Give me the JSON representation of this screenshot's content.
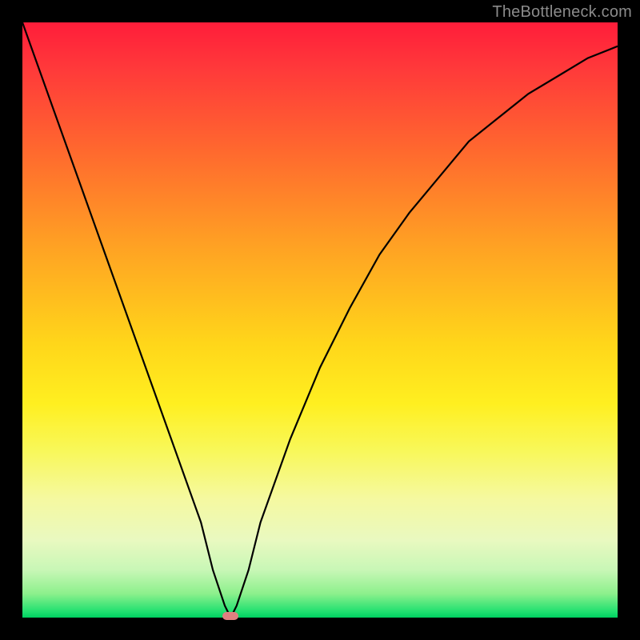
{
  "watermark": "TheBottleneck.com",
  "chart_data": {
    "type": "line",
    "title": "",
    "xlabel": "",
    "ylabel": "",
    "xlim": [
      0,
      100
    ],
    "ylim": [
      0,
      100
    ],
    "x": [
      0,
      5,
      10,
      15,
      20,
      25,
      30,
      32,
      34,
      35,
      36,
      38,
      40,
      45,
      50,
      55,
      60,
      65,
      70,
      75,
      80,
      85,
      90,
      95,
      100
    ],
    "values": [
      100,
      86,
      72,
      58,
      44,
      30,
      16,
      8,
      2,
      0,
      2,
      8,
      16,
      30,
      42,
      52,
      61,
      68,
      74,
      80,
      84,
      88,
      91,
      94,
      96
    ],
    "minimum_x": 35,
    "minimum_y": 0,
    "marker": {
      "x": 35,
      "y": 0,
      "color": "#e08080"
    },
    "background_gradient": {
      "top": "#ff1d3a",
      "mid": "#ffd61a",
      "bottom": "#00d060"
    }
  }
}
